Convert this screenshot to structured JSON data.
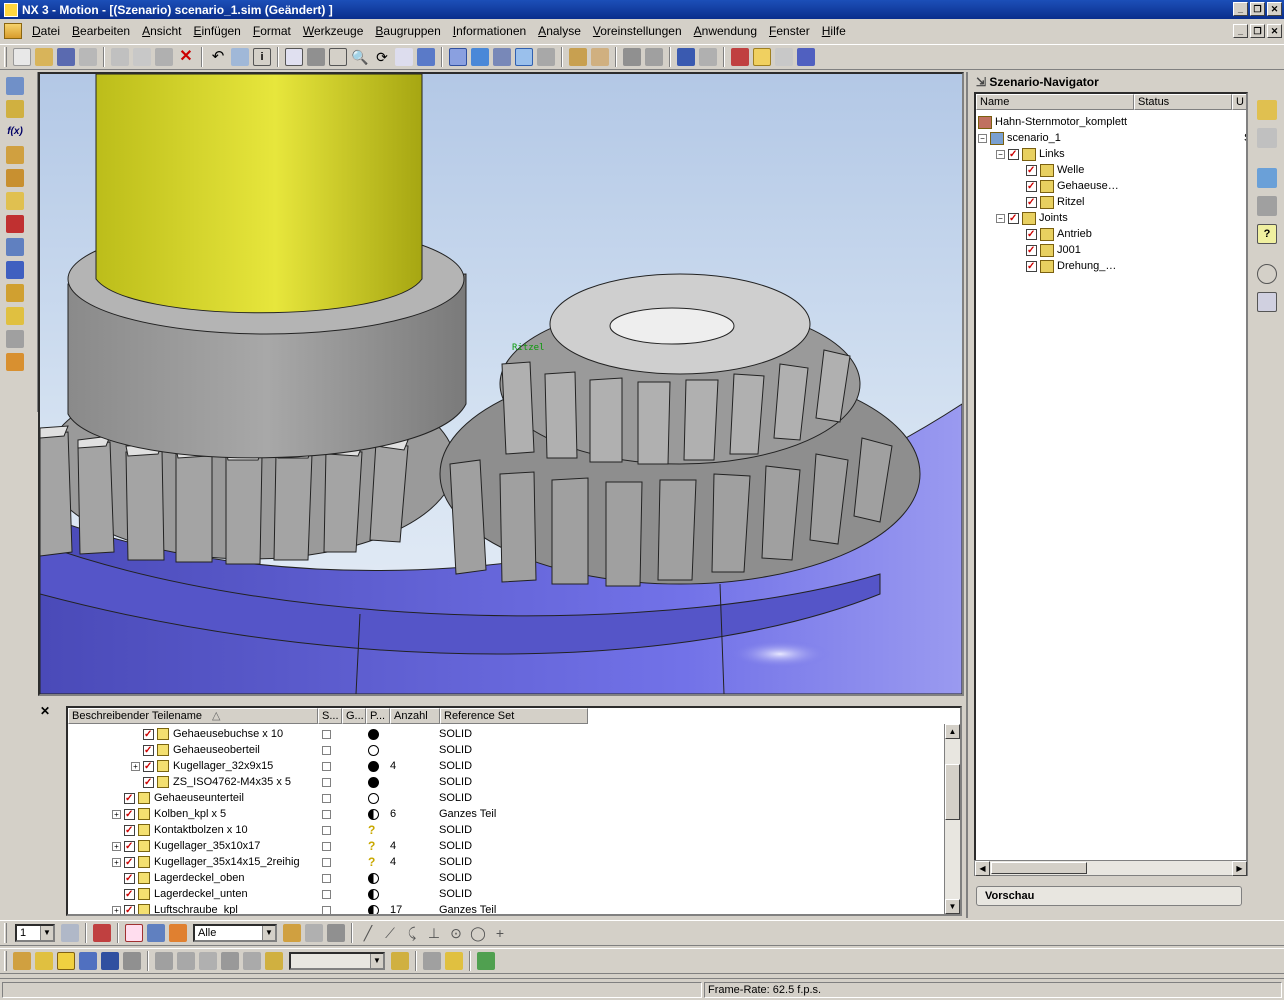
{
  "window": {
    "title": "NX 3 - Motion - [(Szenario) scenario_1.sim (Geändert) ]"
  },
  "menu": {
    "items": [
      {
        "label": "Datei",
        "accel": "D",
        "rest": "atei"
      },
      {
        "label": "Bearbeiten",
        "accel": "B",
        "rest": "earbeiten"
      },
      {
        "label": "Ansicht",
        "accel": "A",
        "rest": "nsicht"
      },
      {
        "label": "Einfügen",
        "accel": "E",
        "rest": "infügen"
      },
      {
        "label": "Format",
        "accel": "F",
        "rest": "ormat"
      },
      {
        "label": "Werkzeuge",
        "accel": "W",
        "rest": "erkzeuge"
      },
      {
        "label": "Baugruppen",
        "accel": "B",
        "rest": "augruppen"
      },
      {
        "label": "Informationen",
        "accel": "I",
        "rest": "nformationen"
      },
      {
        "label": "Analyse",
        "accel": "A",
        "rest": "nalyse"
      },
      {
        "label": "Voreinstellungen",
        "accel": "V",
        "rest": "oreinstellungen"
      },
      {
        "label": "Anwendung",
        "accel": "A",
        "rest": "nwendung"
      },
      {
        "label": "Fenster",
        "accel": "F",
        "rest": "enster"
      },
      {
        "label": "Hilfe",
        "accel": "H",
        "rest": "ilfe"
      }
    ]
  },
  "viewport": {
    "annotation_label": "Ritzel"
  },
  "scenario_navigator": {
    "title": "Szenario-Navigator",
    "columns": [
      "Name",
      "Status",
      "U"
    ],
    "rows": [
      {
        "label": "Hahn-Sternmotor_komplett",
        "status": "",
        "icon": "assembly-icon"
      },
      {
        "label": "scenario_1",
        "status": "Sta",
        "icon": "scenario-icon"
      },
      {
        "label": "Links",
        "status": "",
        "icon": "links-folder-icon"
      },
      {
        "label": "Welle",
        "status": "",
        "icon": "link-icon"
      },
      {
        "label": "Gehaeuse…",
        "status": "",
        "icon": "link-icon"
      },
      {
        "label": "Ritzel",
        "status": "",
        "icon": "link-icon"
      },
      {
        "label": "Joints",
        "status": "",
        "icon": "joints-folder-icon"
      },
      {
        "label": "Antrieb",
        "status": "",
        "icon": "joint-icon"
      },
      {
        "label": "J001",
        "status": "",
        "icon": "joint-icon"
      },
      {
        "label": "Drehung_…",
        "status": "",
        "icon": "joint-icon"
      }
    ],
    "preview_label": "Vorschau"
  },
  "assembly_navigator": {
    "columns": [
      "Beschreibender Teilename",
      "S...",
      "G...",
      "P...",
      "Anzahl",
      "Reference Set"
    ],
    "rows": [
      {
        "name": "Gehaeusebuchse x 10",
        "indent": 2,
        "expand": false,
        "checked": "gray",
        "p": "full",
        "count": "",
        "ref": "SOLID"
      },
      {
        "name": "Gehaeuseoberteil",
        "indent": 2,
        "expand": false,
        "checked": "gray",
        "p": "empty",
        "count": "",
        "ref": "SOLID"
      },
      {
        "name": "Kugellager_32x9x15",
        "indent": 2,
        "expand": true,
        "checked": "gray",
        "p": "full",
        "count": "4",
        "ref": "SOLID"
      },
      {
        "name": "ZS_ISO4762-M4x35 x 5",
        "indent": 2,
        "expand": false,
        "checked": "gray",
        "p": "full",
        "count": "",
        "ref": "SOLID"
      },
      {
        "name": "Gehaeuseunterteil",
        "indent": 1,
        "expand": false,
        "checked": "red",
        "p": "empty",
        "count": "",
        "ref": "SOLID"
      },
      {
        "name": "Kolben_kpl x 5",
        "indent": 1,
        "expand": true,
        "checked": "gray",
        "p": "half",
        "count": "6",
        "ref": "Ganzes Teil"
      },
      {
        "name": "Kontaktbolzen x 10",
        "indent": 1,
        "expand": false,
        "checked": "gray",
        "p": "q",
        "count": "",
        "ref": "SOLID"
      },
      {
        "name": "Kugellager_35x10x17",
        "indent": 1,
        "expand": true,
        "checked": "gray",
        "p": "q",
        "count": "4",
        "ref": "SOLID"
      },
      {
        "name": "Kugellager_35x14x15_2reihig",
        "indent": 1,
        "expand": true,
        "checked": "gray",
        "p": "q",
        "count": "4",
        "ref": "SOLID"
      },
      {
        "name": "Lagerdeckel_oben",
        "indent": 1,
        "expand": false,
        "checked": "gray",
        "p": "half",
        "count": "",
        "ref": "SOLID"
      },
      {
        "name": "Lagerdeckel_unten",
        "indent": 1,
        "expand": false,
        "checked": "gray",
        "p": "half",
        "count": "",
        "ref": "SOLID"
      },
      {
        "name": "Luftschraube_kpl",
        "indent": 1,
        "expand": true,
        "checked": "gray",
        "p": "half",
        "count": "17",
        "ref": "Ganzes Teil"
      }
    ]
  },
  "bottom_toolbar": {
    "layer_combo": "1",
    "filter_combo": "Alle",
    "empty_combo": ""
  },
  "statusbar": {
    "frame_rate": "Frame-Rate: 62.5 f.p.s."
  },
  "colors": {
    "title_bar": "#0a2e8c",
    "shaft_yellow": "#d8d62a",
    "gear_gray": "#9c9c9c",
    "base_blue": "#6a6ae0",
    "check_red": "#c00000"
  }
}
